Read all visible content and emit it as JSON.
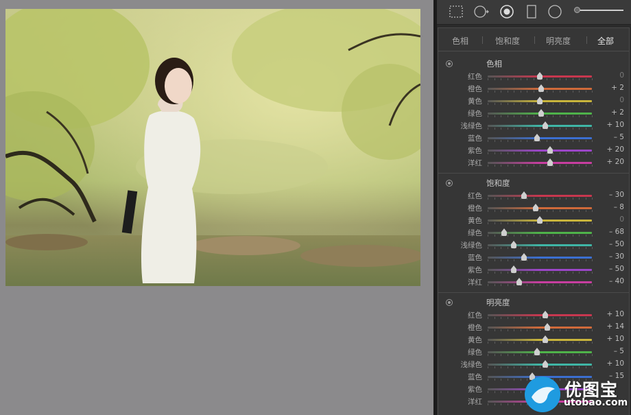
{
  "colors": {
    "panel_bg": "#363636",
    "track_colors": {
      "红色": "#c8374f",
      "橙色": "#d06a3a",
      "黄色": "#c9b53c",
      "绿色": "#4fb34a",
      "浅绿色": "#3fb6a6",
      "蓝色": "#3b6fd1",
      "紫色": "#9b46c8",
      "洋红": "#c83ea0"
    },
    "watermark_blue": "#1f9be0"
  },
  "toolbar": {
    "tools": [
      "crop-overlay-icon",
      "spot-removal-icon",
      "red-eye-icon",
      "graduated-filter-icon",
      "radial-filter-icon"
    ],
    "slider_level": 0.0
  },
  "tabs": [
    {
      "label": "色相",
      "active": false
    },
    {
      "label": "饱和度",
      "active": false
    },
    {
      "label": "明亮度",
      "active": false
    },
    {
      "label": "全部",
      "active": true
    }
  ],
  "sections": [
    {
      "title": "色相",
      "rows": [
        {
          "label": "红色",
          "value": "0",
          "num": 0
        },
        {
          "label": "橙色",
          "value": "+ 2",
          "num": 2
        },
        {
          "label": "黄色",
          "value": "0",
          "num": 0
        },
        {
          "label": "绿色",
          "value": "+ 2",
          "num": 2
        },
        {
          "label": "浅绿色",
          "value": "+ 10",
          "num": 10
        },
        {
          "label": "蓝色",
          "value": "– 5",
          "num": -5
        },
        {
          "label": "紫色",
          "value": "+ 20",
          "num": 20
        },
        {
          "label": "洋红",
          "value": "+ 20",
          "num": 20
        }
      ]
    },
    {
      "title": "饱和度",
      "rows": [
        {
          "label": "红色",
          "value": "– 30",
          "num": -30
        },
        {
          "label": "橙色",
          "value": "– 8",
          "num": -8
        },
        {
          "label": "黄色",
          "value": "0",
          "num": 0
        },
        {
          "label": "绿色",
          "value": "– 68",
          "num": -68
        },
        {
          "label": "浅绿色",
          "value": "– 50",
          "num": -50
        },
        {
          "label": "蓝色",
          "value": "– 30",
          "num": -30
        },
        {
          "label": "紫色",
          "value": "– 50",
          "num": -50
        },
        {
          "label": "洋红",
          "value": "– 40",
          "num": -40
        }
      ]
    },
    {
      "title": "明亮度",
      "rows": [
        {
          "label": "红色",
          "value": "+ 10",
          "num": 10
        },
        {
          "label": "橙色",
          "value": "+ 14",
          "num": 14
        },
        {
          "label": "黄色",
          "value": "+ 10",
          "num": 10
        },
        {
          "label": "绿色",
          "value": "– 5",
          "num": -5
        },
        {
          "label": "浅绿色",
          "value": "+ 10",
          "num": 10
        },
        {
          "label": "蓝色",
          "value": "– 15",
          "num": -15
        },
        {
          "label": "紫色",
          "value": "",
          "num": 0
        },
        {
          "label": "洋红",
          "value": "",
          "num": 0
        }
      ]
    }
  ],
  "watermark": {
    "text": "优图宝",
    "url": "utobao.com"
  }
}
